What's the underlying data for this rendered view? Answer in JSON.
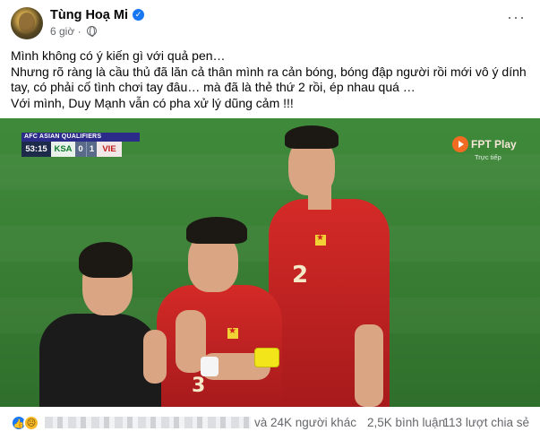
{
  "post": {
    "author": "Tùng Hoạ Mi",
    "verified_icon": "verified-badge-icon",
    "time": "6 giờ",
    "audience_icon": "globe-icon",
    "more_icon": "more-horizontal-icon",
    "lines": [
      "Mình không có ý kiến gì với quả pen…",
      "Nhưng rõ ràng là cầu thủ đã lăn cả thân mình ra cản bóng, bóng đập người rồi mới vô ý dính tay, có phải cố tình chơi tay đâu… mà đã là thẻ thứ 2 rồi, ép nhau quá …",
      "Với mình, Duy Mạnh vẫn có pha xử lý dũng cảm !!!"
    ]
  },
  "media": {
    "scorebug": {
      "competition": "AFC ASIAN QUALIFIERS",
      "clock": "53:15",
      "team1": "KSA",
      "score1": "0",
      "score2": "1",
      "team2": "VIE"
    },
    "broadcaster": {
      "name": "FPT Play",
      "subtitle": "Trực tiếp"
    },
    "jersey_numbers": [
      "2",
      "3"
    ]
  },
  "footer": {
    "reaction_icons": [
      "like-icon",
      "sad-icon"
    ],
    "others_text": "và 24K người khác",
    "comments_text": "2,5K bình luận",
    "shares_text": "113 lượt chia sẻ"
  },
  "colors": {
    "accent": "#1877f2",
    "jersey_red": "#c8201f",
    "pitch_green": "#3a7f35",
    "muted_text": "#65676b"
  }
}
